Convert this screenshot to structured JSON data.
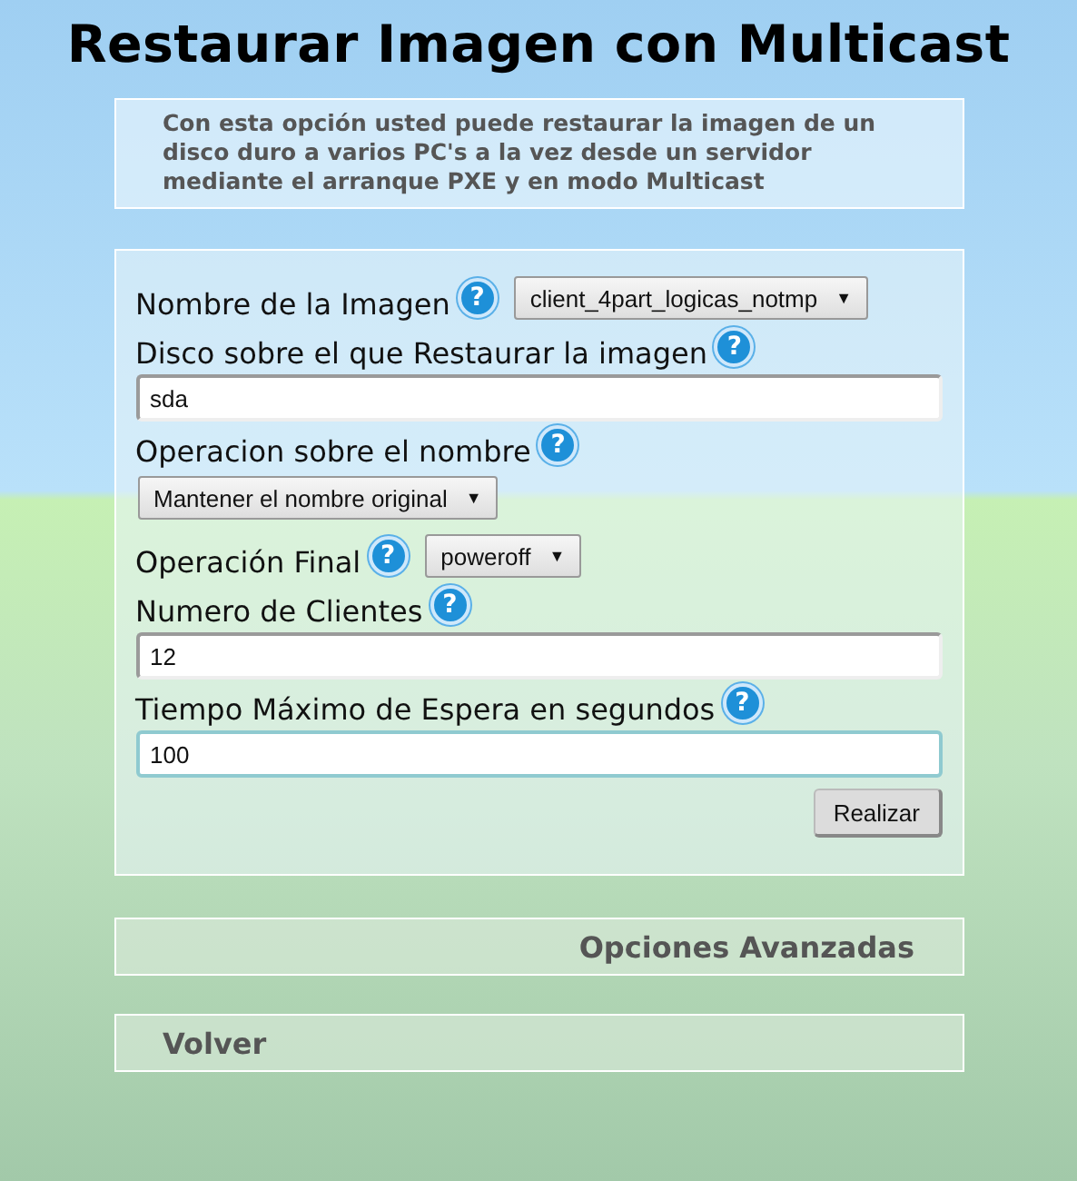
{
  "title": "Restaurar Imagen con Multicast",
  "description": "Con esta opción usted puede restaurar la imagen de un disco duro a varios PC's a la vez desde un servidor mediante el arranque PXE y en modo Multicast",
  "fields": [
    {
      "label": "Nombre de la Imagen",
      "help": "?",
      "kind": "select",
      "inline": true,
      "value": "client_4part_logicas_notmp",
      "caret": "▼",
      "focused": false
    },
    {
      "label": "Disco sobre el que Restaurar la imagen",
      "help": "?",
      "kind": "text",
      "inline": false,
      "value": "sda",
      "focused": false
    },
    {
      "label": "Operacion sobre el nombre",
      "help": "?",
      "kind": "select",
      "inline": false,
      "value": "Mantener el nombre original",
      "caret": "▼",
      "focused": false
    },
    {
      "label": "Operación Final",
      "help": "?",
      "kind": "select",
      "inline": true,
      "value": "poweroff",
      "caret": "▼",
      "focused": false
    },
    {
      "label": "Numero de Clientes",
      "help": "?",
      "kind": "text",
      "inline": false,
      "value": "12",
      "focused": false
    },
    {
      "label": "Tiempo Máximo de Espera en segundos",
      "help": "?",
      "kind": "text",
      "inline": false,
      "value": "100",
      "focused": true
    }
  ],
  "submit": "Realizar",
  "advanced": "Opciones Avanzadas",
  "back": "Volver"
}
